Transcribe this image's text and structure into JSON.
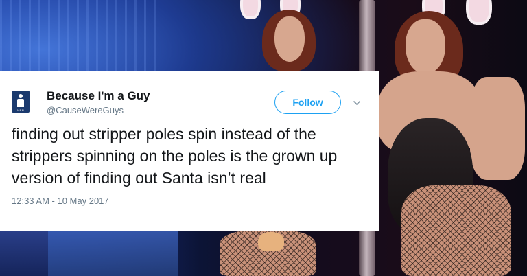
{
  "tweet": {
    "avatar_label": "MEN",
    "display_name": "Because I'm a Guy",
    "handle": "@CauseWereGuys",
    "follow_label": "Follow",
    "menu_icon": "chevron-down-icon",
    "text": "finding out stripper poles spin instead of the strippers spinning on the poles is the grown up version of finding out Santa isn’t real",
    "timestamp": "12:33 AM - 10 May 2017"
  },
  "colors": {
    "follow_accent": "#1da1f2",
    "secondary_text": "#657786",
    "avatar_bg": "#1b3a6e"
  }
}
